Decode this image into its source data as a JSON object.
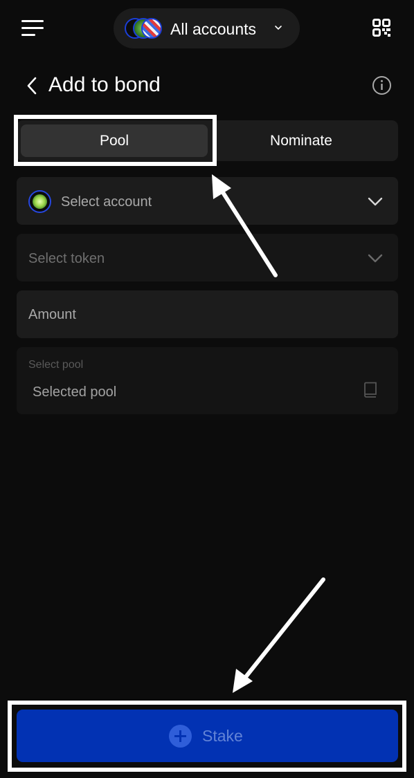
{
  "header": {
    "menu_icon": "hamburger-menu-icon",
    "account_selector": "All accounts",
    "account_chevron_icon": "chevron-down-icon",
    "qr_icon": "qr-code-icon"
  },
  "title_row": {
    "back_icon": "chevron-left-icon",
    "title": "Add to bond",
    "info_icon": "info-circle-icon"
  },
  "tabs": [
    {
      "label": "Pool",
      "selected": true
    },
    {
      "label": "Nominate",
      "selected": false
    }
  ],
  "form": {
    "account": {
      "placeholder": "Select account",
      "icon": "chevron-down-icon"
    },
    "token": {
      "placeholder": "Select token",
      "disabled": true,
      "icon": "chevron-down-icon"
    },
    "amount": {
      "placeholder": "Amount"
    },
    "pool": {
      "label": "Select pool",
      "value": "Selected pool",
      "icon": "book-icon"
    }
  },
  "stake_button": {
    "label": "Stake",
    "icon": "plus-circle-icon",
    "disabled": true
  },
  "colors": {
    "background": "#0c0c0c",
    "surface": "#1c1c1c",
    "selected_tab": "#333333",
    "primary": "#0232b3",
    "annotation": "#ffffff"
  }
}
